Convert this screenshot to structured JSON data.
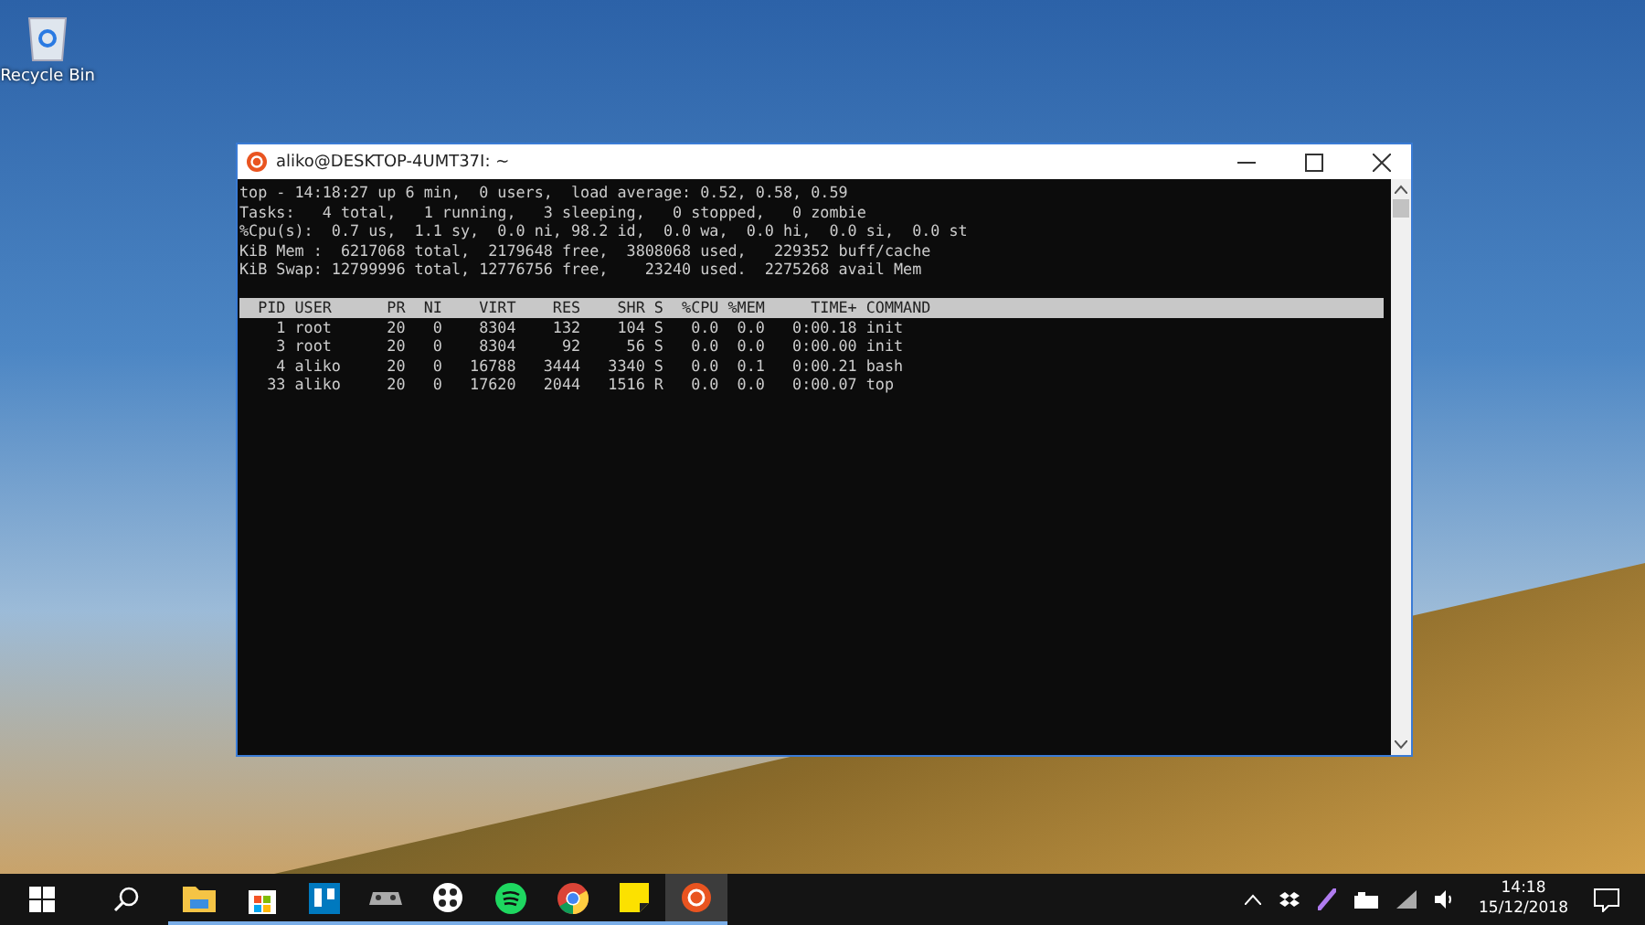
{
  "desktop_icons": [
    {
      "label": "Recycle Bin"
    }
  ],
  "window": {
    "title": "aliko@DESKTOP-4UMT37I: ~",
    "summary_lines": [
      "top - 14:18:27 up 6 min,  0 users,  load average: 0.52, 0.58, 0.59",
      "Tasks:   4 total,   1 running,   3 sleeping,   0 stopped,   0 zombie",
      "%Cpu(s):  0.7 us,  1.1 sy,  0.0 ni, 98.2 id,  0.0 wa,  0.0 hi,  0.0 si,  0.0 st",
      "KiB Mem :  6217068 total,  2179648 free,  3808068 used,   229352 buff/cache",
      "KiB Swap: 12799996 total, 12776756 free,    23240 used.  2275268 avail Mem"
    ],
    "process_header": "  PID USER      PR  NI    VIRT    RES    SHR S  %CPU %MEM     TIME+ COMMAND",
    "processes": [
      "    1 root      20   0    8304    132    104 S   0.0  0.0   0:00.18 init",
      "    3 root      20   0    8304     92     56 S   0.0  0.0   0:00.00 init",
      "    4 aliko     20   0   16788   3444   3340 S   0.0  0.1   0:00.21 bash",
      "   33 aliko     20   0   17620   2044   1516 R   0.0  0.0   0:00.07 top"
    ]
  },
  "taskbar": {
    "apps": [
      {
        "kind": "explorer",
        "selected": false
      },
      {
        "kind": "store",
        "selected": false
      },
      {
        "kind": "trello",
        "selected": false
      },
      {
        "kind": "game",
        "selected": false
      },
      {
        "kind": "dots",
        "selected": false
      },
      {
        "kind": "spotify",
        "selected": false
      },
      {
        "kind": "chrome",
        "selected": false
      },
      {
        "kind": "sticky",
        "selected": false
      },
      {
        "kind": "ubuntu",
        "selected": true
      }
    ],
    "time": "14:18",
    "date": "15/12/2018"
  }
}
